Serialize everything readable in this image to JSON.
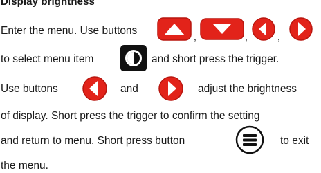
{
  "heading": "Display brightness",
  "colors": {
    "red_button": "#e2231a",
    "red_button_dark": "#b8160f",
    "black": "#111111",
    "text": "#1a1a1a"
  },
  "paragraph": {
    "line1": "Enter the menu. Use buttons",
    "sep1": ",",
    "sep2": ",",
    "sep3": ",",
    "line2_a": "to select menu item",
    "line2_b": "and short press the trigger.",
    "line3_a": "Use buttons",
    "line3_b": "and",
    "line3_c": "adjust the brightness",
    "line4": "of display. Short press the trigger to confirm the setting",
    "line5_a": "and return to menu. Short press button",
    "line5_b": "to exit",
    "line6": "the menu."
  },
  "icons": {
    "up": "up-arrow-button-icon",
    "down": "down-arrow-button-icon",
    "left": "left-arrow-button-icon",
    "right": "right-arrow-button-icon",
    "brightness": "brightness-menu-icon",
    "menu": "menu-button-icon"
  }
}
